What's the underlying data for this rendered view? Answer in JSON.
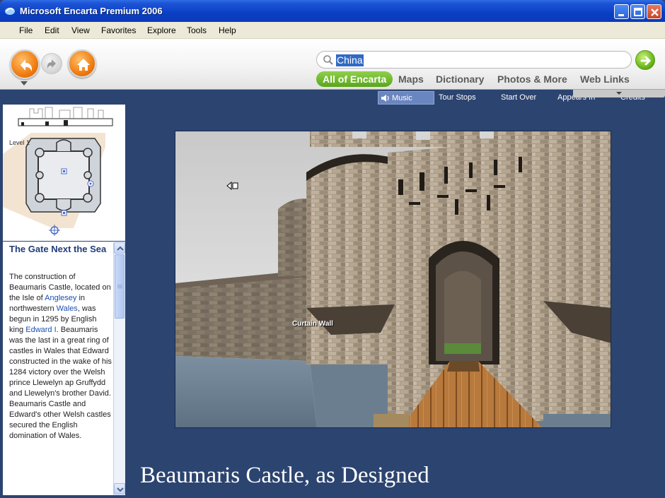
{
  "window": {
    "title": "Microsoft Encarta Premium 2006"
  },
  "menu": {
    "items": [
      "File",
      "Edit",
      "View",
      "Favorites",
      "Explore",
      "Tools",
      "Help"
    ]
  },
  "toolbar": {
    "search_value": "China",
    "search_placeholder": "",
    "scope_tabs": [
      "All of Encarta",
      "Maps",
      "Dictionary",
      "Photos & More",
      "Web Links"
    ],
    "active_scope": "All of Encarta",
    "accent_color": "#f07d12",
    "active_tab_color": "#5aa51c"
  },
  "media_bar": {
    "music": "Music",
    "tour_stops": "Tour Stops",
    "start_over": "Start Over",
    "appears_in": "Appears In",
    "credits": "Credits"
  },
  "left_panel": {
    "level_label": "Level 1",
    "article_title": "The Gate Next the Sea",
    "article": {
      "t1": "The construction of Beaumaris Castle, located on the Isle of ",
      "l1": "Anglesey",
      "t2": " in northwestern ",
      "l2": "Wales",
      "t3": ", was begun in 1295 by English king ",
      "l3": "Edward I",
      "t4": ". Beaumaris was the last in a great ring of castles in Wales that Edward constructed in the wake of his 1284 victory over the Welsh prince Llewelyn ap Gruffydd and Llewelyn's brother David. Beaumaris Castle and Edward's other Welsh castles secured the English domination of Wales."
    }
  },
  "scene": {
    "hotspot_label": "Curtain Wall"
  },
  "caption": "Beaumaris Castle, as Designed"
}
